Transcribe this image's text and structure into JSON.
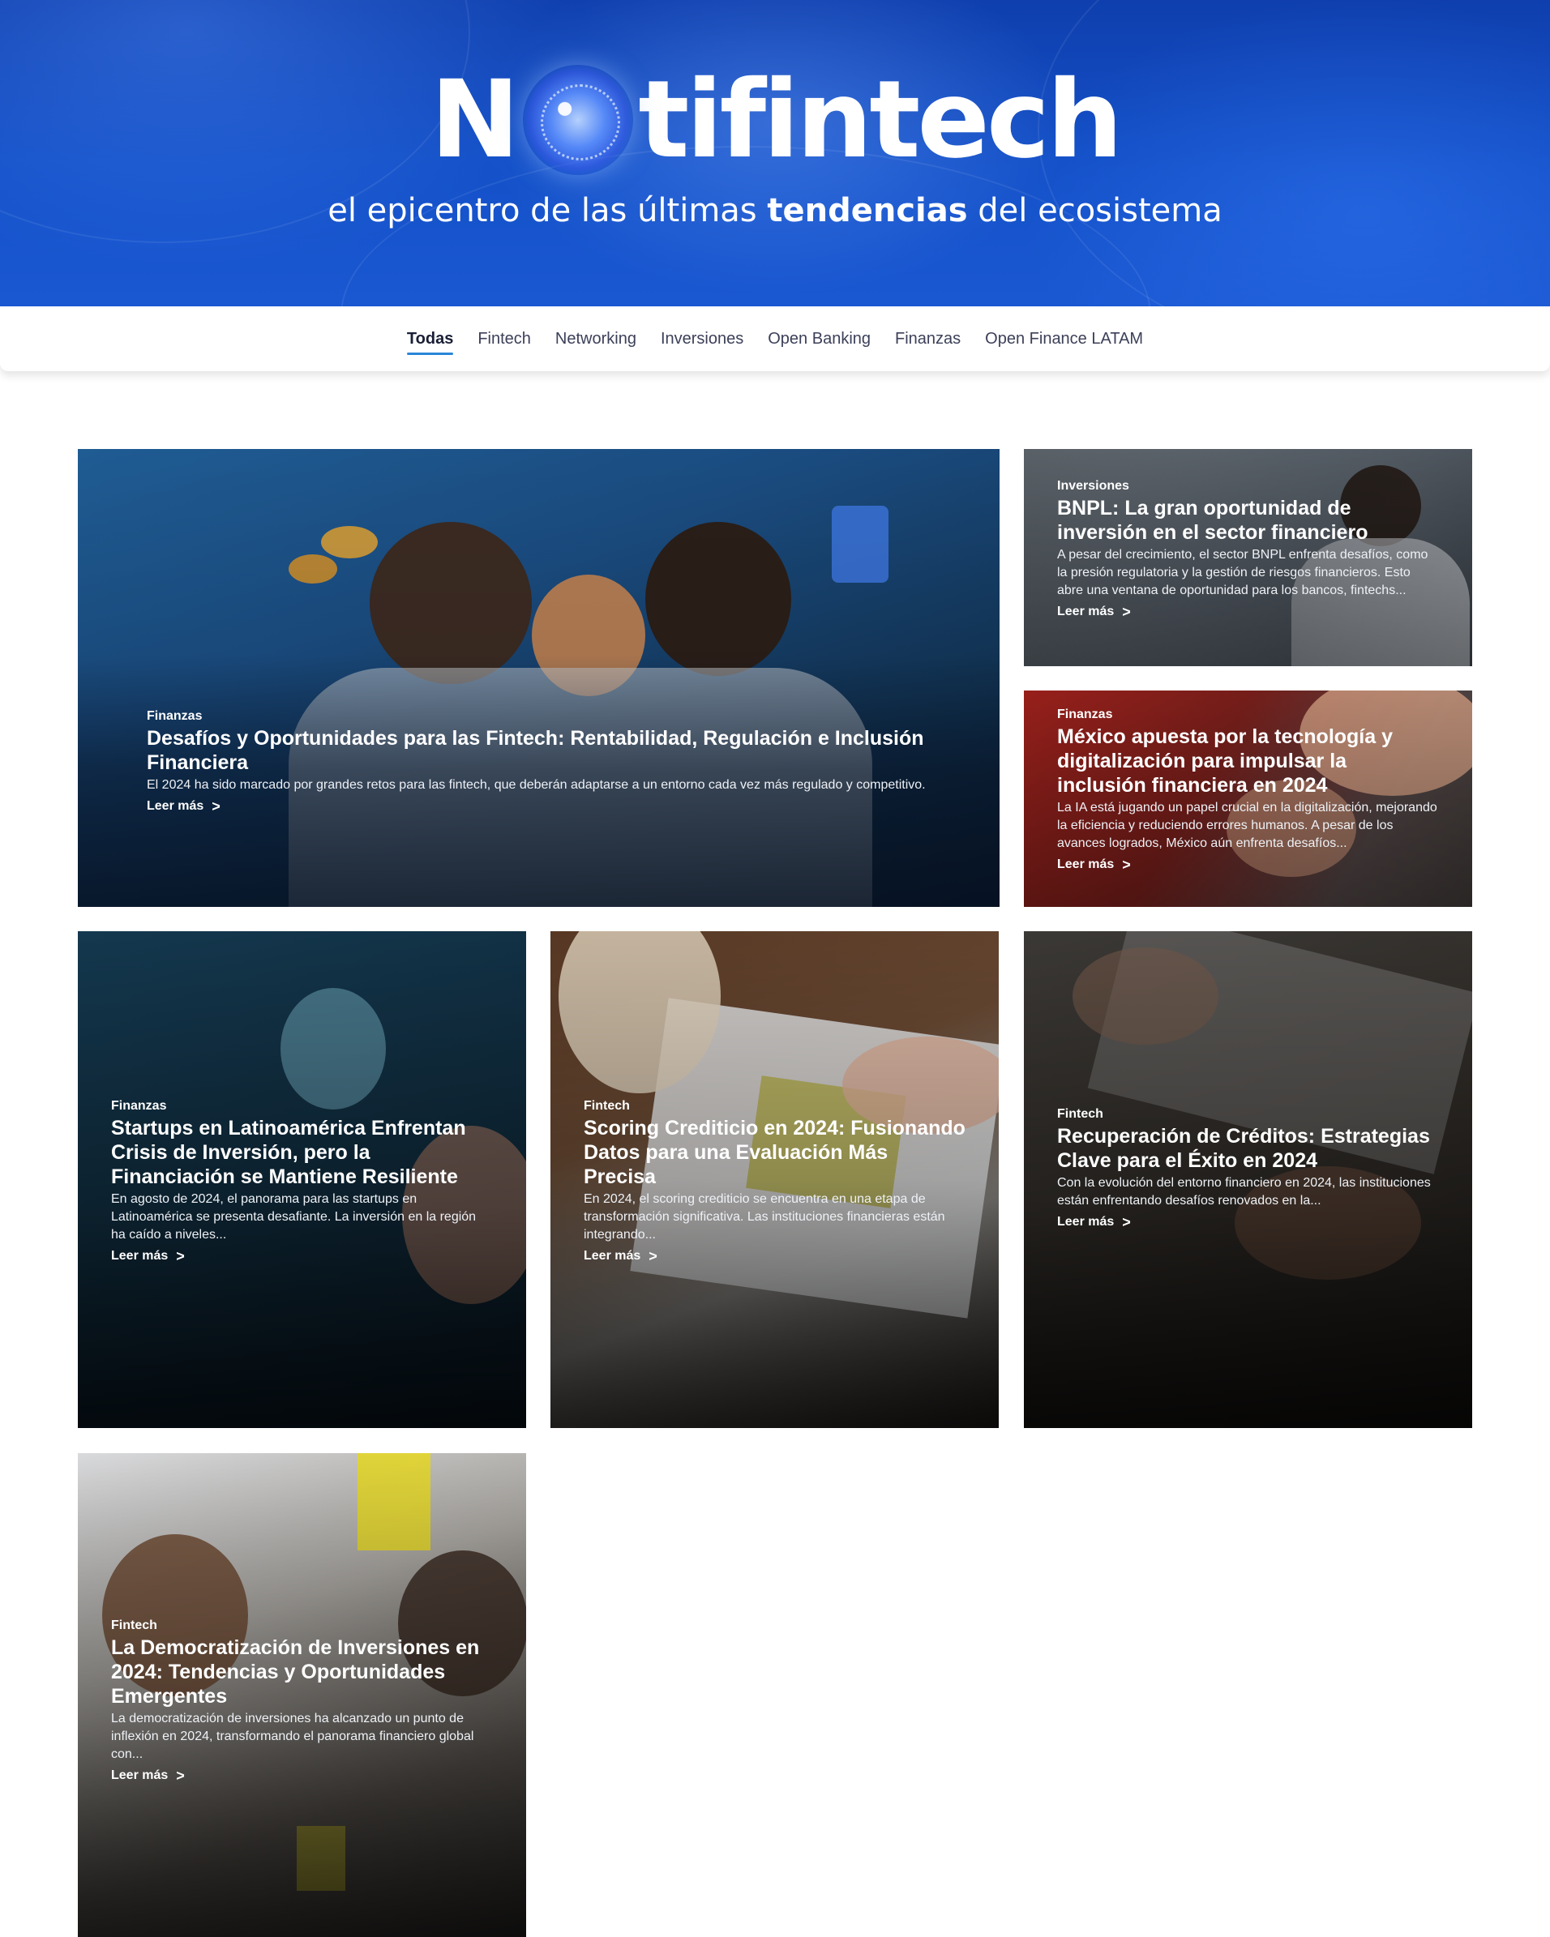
{
  "hero": {
    "logo_left": "N",
    "logo_right": "tifintech",
    "tagline_pre": "el epicentro de las últimas ",
    "tagline_bold": "tendencias",
    "tagline_post": " del ecosistema",
    "colors": {
      "background": "#1451c9",
      "text": "#ffffff"
    },
    "logo_globe_icon": "globe-icon"
  },
  "nav": {
    "active": "Todas",
    "items": [
      "Todas",
      "Fintech",
      "Networking",
      "Inversiones",
      "Open Banking",
      "Finanzas",
      "Open Finance LATAM"
    ],
    "accent": "#2a86d8"
  },
  "posts": [
    {
      "category": "Finanzas",
      "title": "Desafíos y Oportunidades para las Fintech: Rentabilidad, Regulación e Inclusión Financiera",
      "excerpt": "El 2024 ha sido marcado por grandes retos para las fintech, que deberán adaptarse a un entorno cada vez más regulado y competitivo.",
      "more": "Leer más"
    },
    {
      "category": "Inversiones",
      "title": "BNPL: La gran oportunidad de inversión en el sector financiero",
      "excerpt": "A pesar del crecimiento, el sector BNPL enfrenta desafíos, como la presión regulatoria y la gestión de riesgos financieros. Esto abre una ventana de oportunidad para los bancos, fintechs...",
      "more": "Leer más"
    },
    {
      "category": "Finanzas",
      "title": "México apuesta por la tecnología y digitalización para impulsar la inclusión financiera en 2024",
      "excerpt": "La IA está jugando un papel crucial en la digitalización, mejorando la eficiencia y reduciendo errores humanos. A pesar de los avances logrados, México aún enfrenta desafíos...",
      "more": "Leer más"
    },
    {
      "category": "Finanzas",
      "title": "Startups en Latinoamérica Enfrentan Crisis de Inversión, pero la Financiación se Mantiene Resiliente",
      "excerpt": "En agosto de 2024, el panorama para las startups en Latinoamérica se presenta desafiante. La inversión en la región ha caído a niveles...",
      "more": "Leer más"
    },
    {
      "category": "Fintech",
      "title": "Scoring Crediticio en 2024: Fusionando Datos para una Evaluación Más Precisa",
      "excerpt": "En 2024, el scoring crediticio se encuentra en una etapa de transformación significativa. Las instituciones financieras están integrando...",
      "more": "Leer más"
    },
    {
      "category": "Fintech",
      "title": "Recuperación de Créditos: Estrategias Clave para el Éxito en 2024",
      "excerpt": "Con la evolución del entorno financiero en 2024, las instituciones están enfrentando desafíos renovados en la...",
      "more": "Leer más"
    },
    {
      "category": "Fintech",
      "title": "La Democratización de Inversiones en 2024: Tendencias y Oportunidades Emergentes",
      "excerpt": "La democratización de inversiones ha alcanzado un punto de inflexión en 2024, transformando el panorama financiero global con...",
      "more": "Leer más"
    }
  ]
}
